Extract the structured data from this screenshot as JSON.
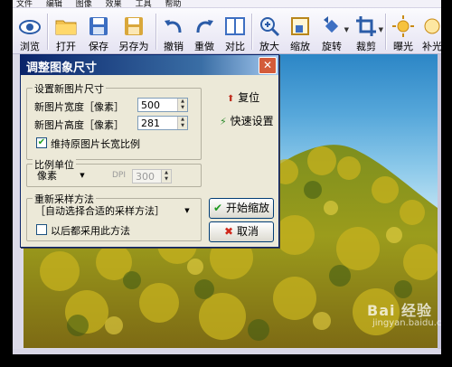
{
  "menu": [
    "文件",
    "编辑",
    "图像",
    "效果",
    "工具",
    "帮助"
  ],
  "toolbar": {
    "browse": "浏览",
    "open": "打开",
    "save": "保存",
    "save_as": "另存为",
    "undo": "撤销",
    "redo": "重做",
    "compare": "对比",
    "zoom_in": "放大",
    "zoom_out": "缩放",
    "rotate": "旋转",
    "crop": "裁剪",
    "exposure": "曝光",
    "more": "补光"
  },
  "dialog": {
    "title": "调整图象尺寸",
    "close": "✕",
    "size_group": "设置新图片尺寸",
    "width_label": "新图片宽度［像素］",
    "width_value": "500",
    "height_label": "新图片高度［像素］",
    "height_value": "281",
    "keep_ratio_label": "维持原图片长宽比例",
    "keep_ratio_checked": true,
    "reset": "复位",
    "quick_set": "快速设置",
    "unit_group": "比例单位",
    "unit_value": "像素",
    "dpi_label": "DPI",
    "dpi_value": "300",
    "resample_group": "重新采样方法",
    "resample_value": "［自动选择合适的采样方法］",
    "later_use_label": "以后都采用此方法",
    "later_use_checked": false,
    "start_button": "开始缩放",
    "cancel_button": "取消"
  },
  "watermark": {
    "brand": "Bai 经验",
    "url": "jingyan.baidu.com"
  },
  "colors": {
    "title_bar": "#0a246a",
    "dialog_bg": "#ece9d8",
    "sky_top": "#2c86c6"
  }
}
